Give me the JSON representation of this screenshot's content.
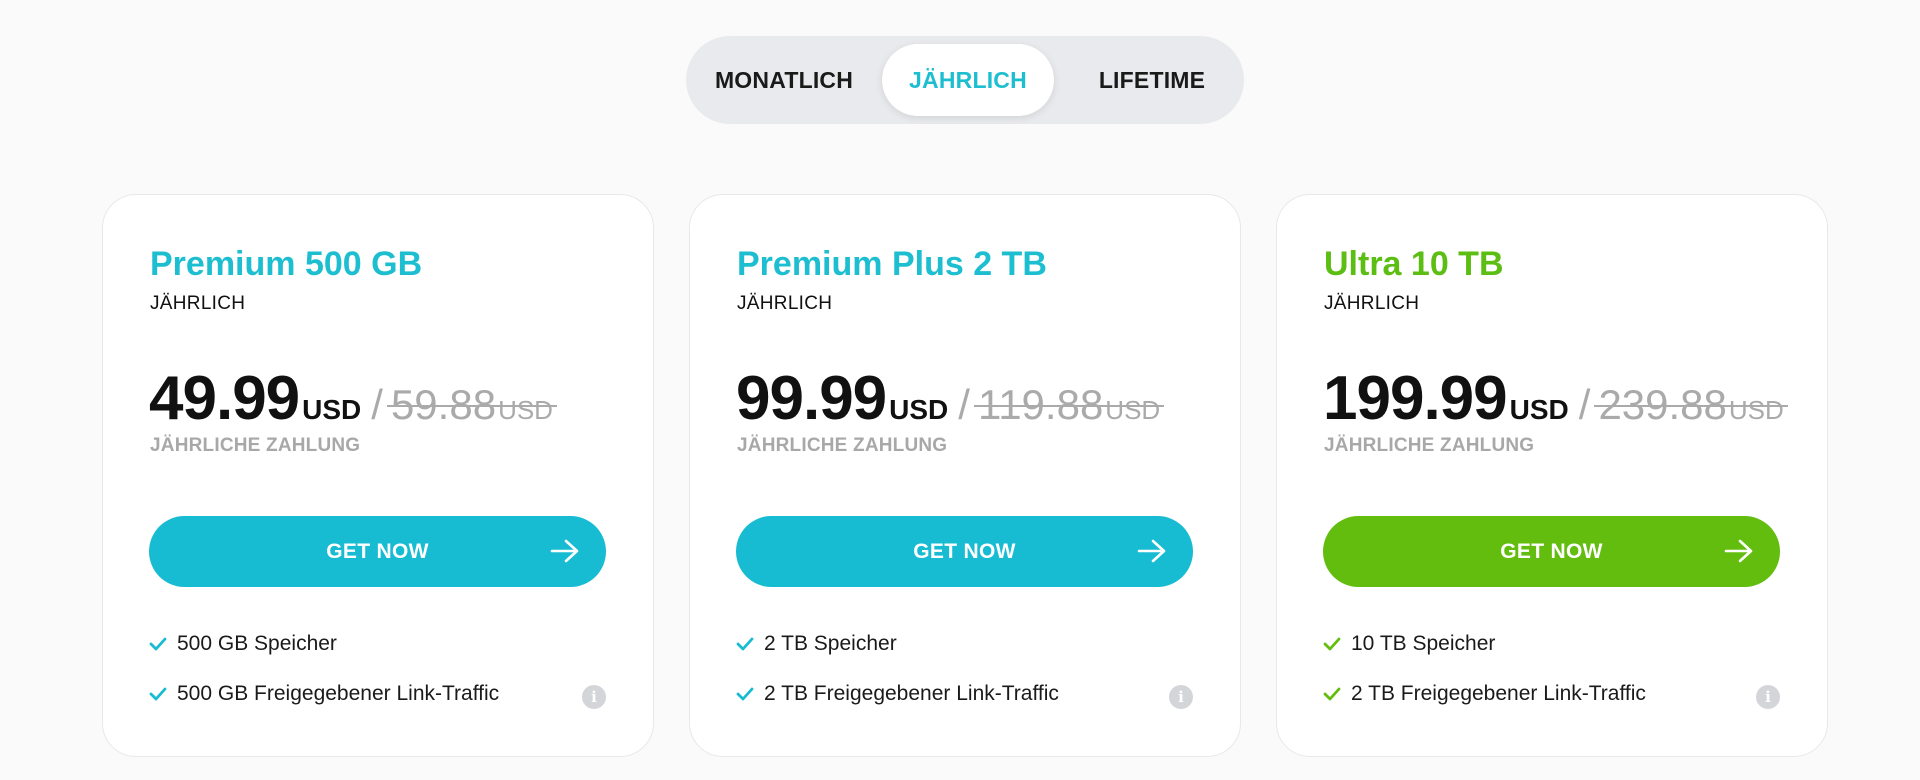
{
  "billing_toggle": {
    "monthly": "MONATLICH",
    "yearly": "JÄHRLICH",
    "lifetime": "LIFETIME",
    "selected": "JÄHRLICH"
  },
  "colors": {
    "accent_teal": "#17bcd2",
    "accent_green": "#62bd0f",
    "muted_gray": "#aaaaaa"
  },
  "plans": [
    {
      "title": "Premium 500 GB",
      "period": "JÄHRLICH",
      "price": "49.99",
      "currency": "USD",
      "separator": "/",
      "old_price": "59.88",
      "old_currency": "USD",
      "payment_note": "JÄHRLICHE ZAHLUNG",
      "cta": "GET NOW",
      "features": [
        "500 GB Speicher",
        "500 GB Freigegebener Link-Traffic"
      ],
      "info_icon": "i"
    },
    {
      "title": "Premium Plus 2 TB",
      "period": "JÄHRLICH",
      "price": "99.99",
      "currency": "USD",
      "separator": "/",
      "old_price": "119.88",
      "old_currency": "USD",
      "payment_note": "JÄHRLICHE ZAHLUNG",
      "cta": "GET NOW",
      "features": [
        "2 TB Speicher",
        "2 TB Freigegebener Link-Traffic"
      ],
      "info_icon": "i"
    },
    {
      "title": "Ultra 10 TB",
      "period": "JÄHRLICH",
      "price": "199.99",
      "currency": "USD",
      "separator": "/",
      "old_price": "239.88",
      "old_currency": "USD",
      "payment_note": "JÄHRLICHE ZAHLUNG",
      "cta": "GET NOW",
      "features": [
        "10 TB Speicher",
        "2 TB Freigegebener Link-Traffic"
      ],
      "info_icon": "i"
    }
  ]
}
